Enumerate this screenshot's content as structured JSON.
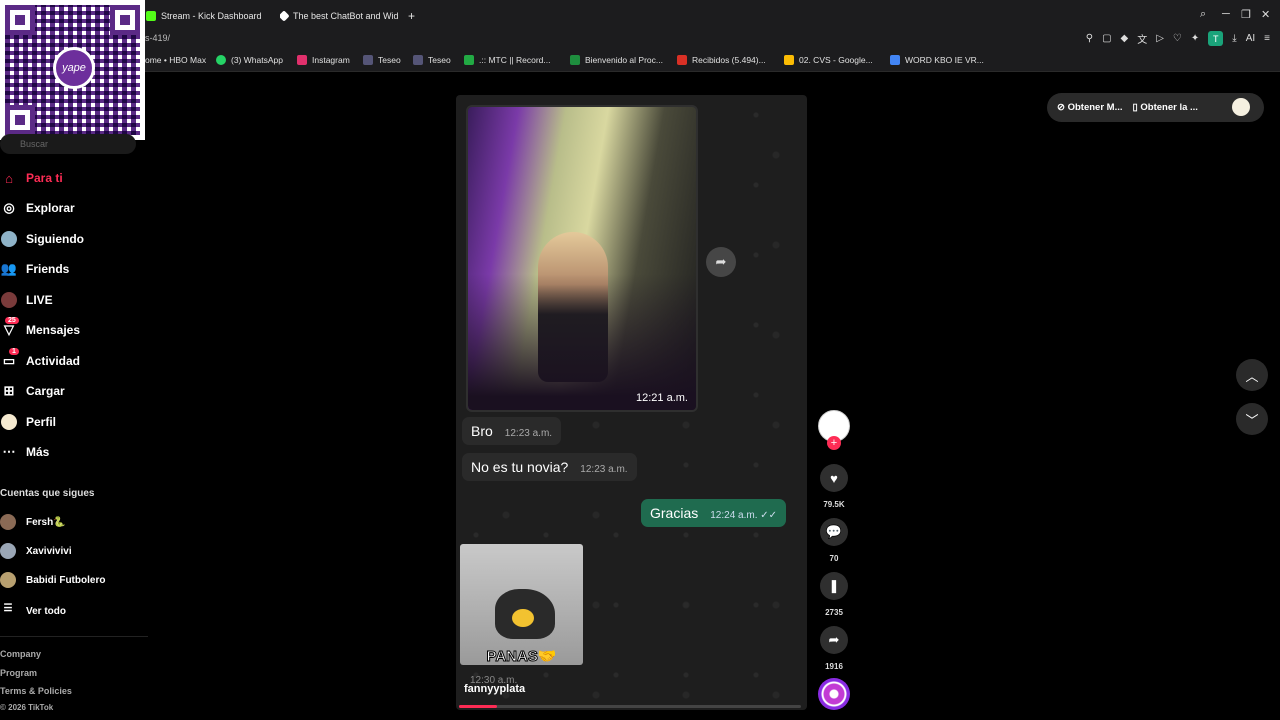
{
  "browser": {
    "tabs": [
      {
        "label": "Stream - Kick Dashboard",
        "color": "#53fc18"
      },
      {
        "label": "The best ChatBot and Wid",
        "color": "#ffffff"
      }
    ],
    "new_tab": "+",
    "address": "s-419/",
    "window_controls": [
      "─",
      "❐",
      "✕"
    ],
    "profile_letter": "T",
    "ai_label": "AI",
    "bookmarks": [
      {
        "label": "ome • HBO Max",
        "color": "#7a3cff"
      },
      {
        "label": "(3) WhatsApp",
        "color": "#25d366"
      },
      {
        "label": "Instagram",
        "color": "#e1306c"
      },
      {
        "label": "Teseo",
        "color": "#555577"
      },
      {
        "label": "Teseo",
        "color": "#555577"
      },
      {
        "label": ".:: MTC || Record...",
        "color": "#22aa44"
      },
      {
        "label": "Bienvenido al Proc...",
        "color": "#1e8e3e"
      },
      {
        "label": "Recibidos (5.494)...",
        "color": "#d93025"
      },
      {
        "label": "02. CVS - Google...",
        "color": "#fbbc04"
      },
      {
        "label": "WORD KBO IE VR...",
        "color": "#4285f4"
      }
    ]
  },
  "qr": {
    "logo_text": "yape"
  },
  "sidebar": {
    "search_placeholder": "Buscar",
    "nav": [
      {
        "label": "Para ti",
        "icon": "home-icon"
      },
      {
        "label": "Explorar",
        "icon": "compass-icon"
      },
      {
        "label": "Siguiendo",
        "icon": "following-icon"
      },
      {
        "label": "Friends",
        "icon": "friends-icon"
      },
      {
        "label": "LIVE",
        "icon": "live-icon"
      },
      {
        "label": "Mensajes",
        "icon": "messages-icon",
        "badge": "25"
      },
      {
        "label": "Actividad",
        "icon": "activity-icon",
        "badge": "1"
      },
      {
        "label": "Cargar",
        "icon": "upload-icon"
      },
      {
        "label": "Perfil",
        "icon": "profile-icon"
      },
      {
        "label": "Más",
        "icon": "more-icon"
      }
    ],
    "following_title": "Cuentas que sigues",
    "accounts": [
      {
        "name": "Fersh🐍"
      },
      {
        "name": "Xavivivivi"
      },
      {
        "name": "Babidi Futbolero"
      }
    ],
    "see_all": "Ver todo",
    "footer": [
      "Company",
      "Program",
      "Terms & Policies"
    ],
    "copyright": "© 2026 TikTok"
  },
  "video": {
    "photo_time": "12:21 a.m.",
    "messages": [
      {
        "text": "Bro",
        "time": "12:23 a.m.",
        "dir": "in"
      },
      {
        "text": "No es tu novia?",
        "time": "12:23 a.m.",
        "dir": "in"
      },
      {
        "text": "Gracias",
        "time": "12:24 a.m. ✓✓",
        "dir": "out"
      }
    ],
    "sticker_text": "PANAS🤝",
    "sticker_time": "12:30 a.m.",
    "author": "fannyyplata",
    "progress": 0.11
  },
  "rail": {
    "likes": "79.5K",
    "comments": "70",
    "saves": "2735",
    "shares": "1916"
  },
  "top_right": {
    "pill1": "Obtener M...",
    "pill2": "Obtener la ..."
  }
}
